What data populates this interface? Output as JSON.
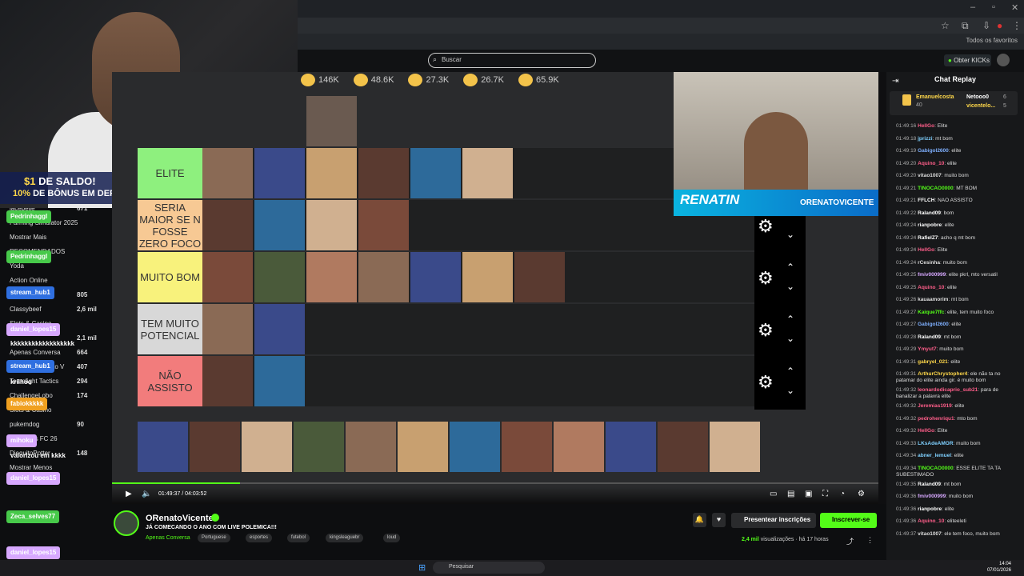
{
  "browser": {
    "favorites": "Todos os favoritos",
    "search_placeholder": "Buscar",
    "get_kicks": "Obter KICKs"
  },
  "promo": {
    "line1_amount": "$1",
    "line1_rest": " DE SALDO!",
    "line2_pct": "10%",
    "line2_rest": " DE BÔNUS EM DEPÓSITOS"
  },
  "left": {
    "rows": [
      {
        "label": "jacepelle",
        "val": "671"
      },
      {
        "label": "Farming Simulator 2025",
        "val": ""
      },
      {
        "label": "Mostrar Mais",
        "val": ""
      },
      {
        "label": "RECOMENDADOS",
        "val": ""
      },
      {
        "label": "Yoda",
        "val": ""
      },
      {
        "label": "Action Online",
        "val": ""
      },
      {
        "label": "",
        "val": "805"
      },
      {
        "label": "Classybeef",
        "val": "2,6 mil"
      },
      {
        "label": "Slots & Casino",
        "val": ""
      },
      {
        "label": "",
        "val": "2,1 mil"
      },
      {
        "label": "Apenas Conversa",
        "val": "664"
      },
      {
        "label": "Grand Theft Auto V",
        "val": "407"
      },
      {
        "label": "Teamfight Tactics",
        "val": "294"
      },
      {
        "label": "ChallengeLobo",
        "val": "174"
      },
      {
        "label": "Slots & Casino",
        "val": ""
      },
      {
        "label": "pukemdog",
        "val": "90"
      },
      {
        "label": "EA Sports FC 26",
        "val": ""
      },
      {
        "label": "DiequitoPotter",
        "val": "148"
      },
      {
        "label": "Mostrar Menos",
        "val": ""
      }
    ],
    "tags": [
      "Pedrinhaggl",
      "Pedrinhaggl",
      "stream_hub1",
      "daniel_lopes15",
      "kkkkkkkkkkkkkkkkkk",
      "stream_hub1",
      "krilhoo",
      "fabiokkkkk",
      "mihoku",
      "valorizou em kkkk",
      "daniel_lopes15",
      "Zeca_selves77",
      "daniel_lopes15"
    ]
  },
  "stats": [
    {
      "v": "146K"
    },
    {
      "v": "48.6K"
    },
    {
      "v": "27.3K"
    },
    {
      "v": "26.7K"
    },
    {
      "v": "65.9K"
    }
  ],
  "tiers": [
    {
      "label": "ELITE",
      "color": "#8ef07e"
    },
    {
      "label": "SERIA MAIOR SE N FOSSE ZERO FOCO",
      "color": "#f7c994"
    },
    {
      "label": "MUITO BOM",
      "color": "#f8f27c"
    },
    {
      "label": "TEM MUITO POTENCIAL",
      "color": "#d8d8d8"
    },
    {
      "label": "NÃO ASSISTO",
      "color": "#f27c7c"
    }
  ],
  "cam2": {
    "name": "RENATIN",
    "handle": "ORENATOVICENTE"
  },
  "video": {
    "time": "01:49:37 / 04:03:52"
  },
  "chat": {
    "title": "Chat Replay",
    "pinned": {
      "user1": "Emanuelcosta",
      "count1": "40",
      "user2": "Netooo0",
      "count2": "6",
      "user3": "vicentelo...",
      "count3": "5"
    },
    "messages": [
      {
        "t": "01:49:16",
        "u": "HellGo",
        "c": "#ff5e8a",
        "m": "Elite"
      },
      {
        "t": "01:49:18",
        "u": "jprizzi",
        "c": "#7fd0ff",
        "m": "mt bom"
      },
      {
        "t": "01:49:19",
        "u": "Gabigol2600",
        "c": "#7fb0ff",
        "m": "elite"
      },
      {
        "t": "01:49:20",
        "u": "Aquino_10",
        "c": "#ff5e8a",
        "m": "elite"
      },
      {
        "t": "01:49:20",
        "u": "vitao1007",
        "c": "#dddddd",
        "m": "muito bom"
      },
      {
        "t": "01:49:21",
        "u": "TINOCAO0000",
        "c": "#53fc18",
        "m": "MT BOM"
      },
      {
        "t": "01:49:21",
        "u": "FFLCH",
        "c": "#ffffff",
        "m": "NAO ASSISTO"
      },
      {
        "t": "01:49:22",
        "u": "Raland09",
        "c": "#ffffff",
        "m": "bom"
      },
      {
        "t": "01:49:24",
        "u": "rianpobre",
        "c": "#ffffff",
        "m": "elite"
      },
      {
        "t": "01:49:24",
        "u": "RafielZ7",
        "c": "#ffffff",
        "m": "acho q mt bom"
      },
      {
        "t": "01:49:24",
        "u": "HellGo",
        "c": "#ff5e8a",
        "m": "Elite"
      },
      {
        "t": "01:49:24",
        "u": "rCesinha",
        "c": "#dddddd",
        "m": "muito bom"
      },
      {
        "t": "01:49:25",
        "u": "fmiv000999",
        "c": "#d7a8ff",
        "m": "elite pkrl, mto versatil"
      },
      {
        "t": "01:49:25",
        "u": "Aquino_10",
        "c": "#ff5e8a",
        "m": "elite"
      },
      {
        "t": "01:49:26",
        "u": "kauaamorim",
        "c": "#dddddd",
        "m": "mt bom"
      },
      {
        "t": "01:49:27",
        "u": "Kaique7ffc",
        "c": "#53fc18",
        "m": "elite, tem muito foco"
      },
      {
        "t": "01:49:27",
        "u": "Gabigol2600",
        "c": "#7fb0ff",
        "m": "elite"
      },
      {
        "t": "01:49:28",
        "u": "Raland09",
        "c": "#ffffff",
        "m": "mt bom"
      },
      {
        "t": "01:49:29",
        "u": "Ymyut7",
        "c": "#ff5e8a",
        "m": "muito bom"
      },
      {
        "t": "01:49:31",
        "u": "gabryel_021",
        "c": "#ffd84a",
        "m": "elite"
      },
      {
        "t": "01:49:31",
        "u": "ArthurChrystopher4",
        "c": "#ffd84a",
        "m": "ele não ta no patamar do elite ainda gir. é muito bom"
      },
      {
        "t": "01:49:32",
        "u": "leonardodicaprio_sub21",
        "c": "#ff5e8a",
        "m": "para de banalizar a palavra elite"
      },
      {
        "t": "01:49:32",
        "u": "Jeremias1919",
        "c": "#ff5e8a",
        "m": "elite"
      },
      {
        "t": "01:49:32",
        "u": "pedrohenriqu1",
        "c": "#ff5e8a",
        "m": "mto bom"
      },
      {
        "t": "01:49:32",
        "u": "HellGo",
        "c": "#ff5e8a",
        "m": "Elite"
      },
      {
        "t": "01:49:33",
        "u": "LKsAdeAMOR",
        "c": "#7fd0ff",
        "m": "muito bom"
      },
      {
        "t": "01:49:34",
        "u": "abner_lemuel",
        "c": "#7fd0ff",
        "m": "elite"
      },
      {
        "t": "01:49:34",
        "u": "TINOCAO0000",
        "c": "#53fc18",
        "m": "ESSE ELITE TA TA SUBESTIMADO"
      },
      {
        "t": "01:49:35",
        "u": "Raland09",
        "c": "#ffffff",
        "m": "mt bom"
      },
      {
        "t": "01:49:36",
        "u": "fmiv000999",
        "c": "#d7a8ff",
        "m": "muito bom"
      },
      {
        "t": "01:49:36",
        "u": "rianpobre",
        "c": "#ffffff",
        "m": "elite"
      },
      {
        "t": "01:49:36",
        "u": "Aquino_10",
        "c": "#ff5e8a",
        "m": "eliteeleti"
      },
      {
        "t": "01:49:37",
        "u": "vitao1007",
        "c": "#dddddd",
        "m": "ele tem foco, muito bom"
      }
    ]
  },
  "channel": {
    "name": "ORenatoVicente",
    "title": "JÁ COMECANDO O ANO COM LIVE POLEMICA!!!",
    "category": "Apenas Conversa",
    "tags": [
      "Portuguese",
      "esportes",
      "futebol",
      "kingsleaguebr",
      "loud"
    ],
    "gift": "Presentear inscrições",
    "subscribe": "Inscrever-se",
    "views_count": "2,4 mil",
    "views_rest": " visualizações · há 17 horas"
  },
  "taskbar": {
    "search": "Pesquisar",
    "time": "14:04",
    "date": "07/01/2026"
  }
}
